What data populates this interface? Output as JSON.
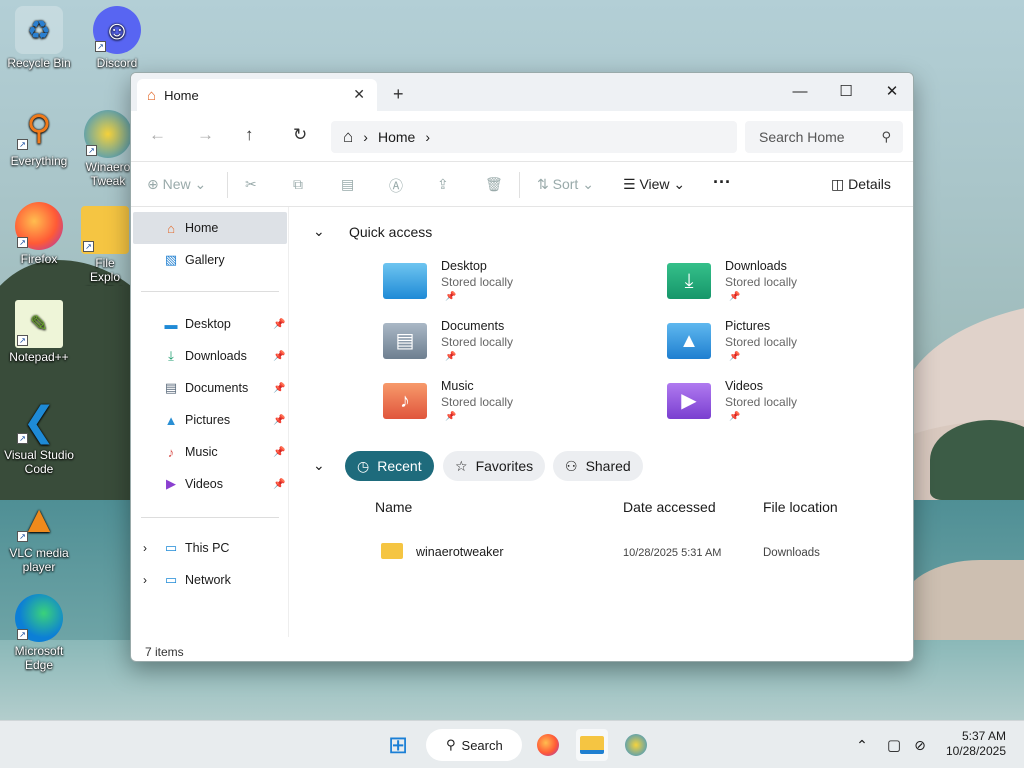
{
  "desktop": {
    "icons": [
      {
        "label": "Recycle Bin",
        "icon": "recycle-bin-icon"
      },
      {
        "label": "Discord",
        "icon": "discord-icon"
      },
      {
        "label": "Everything",
        "icon": "everything-icon"
      },
      {
        "label": "Winaero Tweak",
        "icon": "winaero-icon"
      },
      {
        "label": "Firefox",
        "icon": "firefox-icon"
      },
      {
        "label": "File Explo (No Tab",
        "icon": "folder-icon"
      },
      {
        "label": "Notepad++",
        "icon": "notepadpp-icon"
      },
      {
        "label": "Visual Studio Code",
        "icon": "vscode-icon"
      },
      {
        "label": "VLC media player",
        "icon": "vlc-icon"
      },
      {
        "label": "Microsoft Edge",
        "icon": "edge-icon"
      }
    ]
  },
  "window": {
    "tab_title": "Home",
    "breadcrumb": "Home",
    "search_placeholder": "Search Home",
    "toolbar": {
      "new_label": "New",
      "sort_label": "Sort",
      "view_label": "View",
      "details_label": "Details"
    },
    "nav": {
      "top": [
        "Home",
        "Gallery"
      ],
      "pinned": [
        "Desktop",
        "Downloads",
        "Documents",
        "Pictures",
        "Music",
        "Videos"
      ],
      "tree": [
        "This PC",
        "Network"
      ]
    },
    "quick_access_title": "Quick access",
    "quick_access": [
      {
        "name": "Desktop",
        "sub": "Stored locally"
      },
      {
        "name": "Downloads",
        "sub": "Stored locally"
      },
      {
        "name": "Documents",
        "sub": "Stored locally"
      },
      {
        "name": "Pictures",
        "sub": "Stored locally"
      },
      {
        "name": "Music",
        "sub": "Stored locally"
      },
      {
        "name": "Videos",
        "sub": "Stored locally"
      }
    ],
    "filters": [
      "Recent",
      "Favorites",
      "Shared"
    ],
    "columns": [
      "Name",
      "Date accessed",
      "File location"
    ],
    "rows": [
      {
        "name": "winaerotweaker",
        "date": "10/28/2025 5:31 AM",
        "location": "Downloads"
      }
    ],
    "status": "7 items"
  },
  "taskbar": {
    "search_label": "Search",
    "time": "5:37 AM",
    "date": "10/28/2025"
  },
  "colors": {
    "accent": "#1e6b7c",
    "home_icon": "#e36b2c"
  }
}
